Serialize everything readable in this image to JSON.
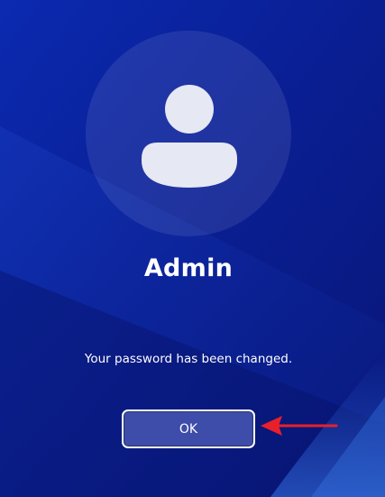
{
  "account": {
    "username": "Admin",
    "avatar_icon": "user-silhouette-icon"
  },
  "dialog": {
    "message": "Your password has been changed.",
    "ok_label": "OK"
  },
  "annotation": {
    "icon": "red-arrow-icon",
    "color": "#e8202a"
  },
  "colors": {
    "background": "#0a1f95",
    "button_fill": "#3e4da9",
    "text": "#ffffff"
  }
}
